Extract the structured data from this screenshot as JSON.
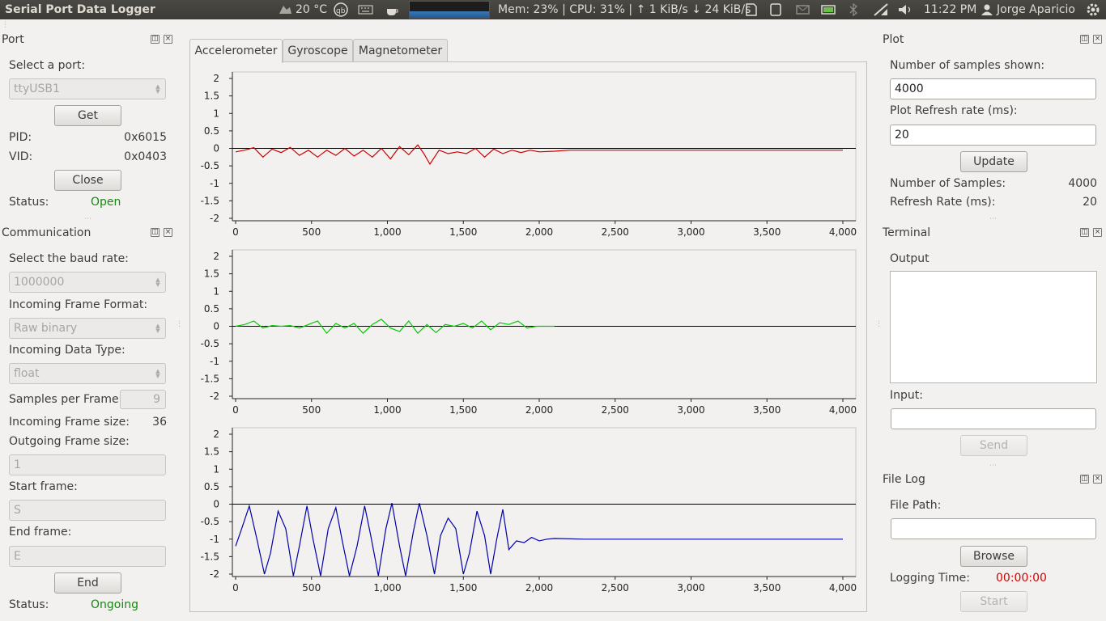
{
  "topbar": {
    "title": "Serial Port Data Logger",
    "weather": "20 °C",
    "sysmon": "Mem: 23% | CPU: 31% | ↑ 1 KiB/s ↓ 24 KiB/s",
    "time": "11:22 PM",
    "user": "Jorge Aparicio"
  },
  "port": {
    "title": "Port",
    "select_label": "Select a port:",
    "port_value": "ttyUSB1",
    "get_label": "Get",
    "pid_label": "PID:",
    "pid_value": "0x6015",
    "vid_label": "VID:",
    "vid_value": "0x0403",
    "close_label": "Close",
    "status_label": "Status:",
    "status_value": "Open"
  },
  "communication": {
    "title": "Communication",
    "baud_label": "Select the baud rate:",
    "baud_value": "1000000",
    "frame_format_label": "Incoming Frame Format:",
    "frame_format_value": "Raw binary",
    "data_type_label": "Incoming Data Type:",
    "data_type_value": "float",
    "samples_label": "Samples per Frame:",
    "samples_value": "9",
    "in_size_label": "Incoming Frame size:",
    "in_size_value": "36",
    "out_size_label": "Outgoing Frame size:",
    "out_size_value": "1",
    "start_label": "Start frame:",
    "start_value": "S",
    "end_label": "End frame:",
    "end_value": "E",
    "end_button": "End",
    "status_label": "Status:",
    "status_value": "Ongoing"
  },
  "tabs": [
    "Accelerometer",
    "Gyroscope",
    "Magnetometer"
  ],
  "plot_settings": {
    "title": "Plot",
    "samples_label": "Number of samples shown:",
    "samples_value": "4000",
    "refresh_label": "Plot Refresh rate (ms):",
    "refresh_value": "20",
    "update_label": "Update",
    "num_samples_label": "Number of Samples:",
    "num_samples_value": "4000",
    "refresh_rate_label": "Refresh Rate (ms):",
    "refresh_rate_value": "20"
  },
  "terminal": {
    "title": "Terminal",
    "output_label": "Output",
    "input_label": "Input:",
    "input_value": "",
    "send_label": "Send"
  },
  "filelog": {
    "title": "File Log",
    "path_label": "File Path:",
    "path_value": "",
    "browse_label": "Browse",
    "time_label": "Logging Time:",
    "time_value": "00:00:00",
    "start_label": "Start"
  },
  "chart_data": [
    {
      "type": "line",
      "color": "#cc0000",
      "xlim": [
        0,
        4000
      ],
      "ylim": [
        -2,
        2
      ],
      "xticks": [
        "0",
        "500",
        "1,000",
        "1,500",
        "2,000",
        "2,500",
        "3,000",
        "3,500",
        "4,000"
      ],
      "yticks": [
        "2",
        "1.5",
        "1",
        "0.5",
        "0",
        "-0.5",
        "-1",
        "-1.5",
        "-2"
      ],
      "series": [
        {
          "x": [
            0,
            60,
            120,
            180,
            240,
            300,
            360,
            420,
            480,
            540,
            600,
            660,
            720,
            780,
            840,
            900,
            960,
            1020,
            1080,
            1140,
            1200,
            1240,
            1280,
            1340,
            1400,
            1460,
            1520,
            1580,
            1640,
            1700,
            1760,
            1820,
            1880,
            1940,
            2000,
            2100,
            2200,
            2400,
            2600,
            3000,
            3500,
            4000
          ],
          "y": [
            -0.1,
            -0.05,
            0.02,
            -0.25,
            -0.02,
            -0.12,
            0.03,
            -0.2,
            -0.05,
            -0.25,
            -0.05,
            -0.2,
            0.0,
            -0.22,
            -0.05,
            -0.25,
            0.0,
            -0.3,
            0.05,
            -0.18,
            0.1,
            -0.15,
            -0.45,
            -0.05,
            -0.15,
            -0.1,
            -0.15,
            0.0,
            -0.25,
            -0.02,
            -0.15,
            -0.05,
            -0.12,
            -0.05,
            -0.1,
            -0.08,
            -0.05,
            -0.05,
            -0.05,
            -0.05,
            -0.05,
            -0.05
          ]
        }
      ]
    },
    {
      "type": "line",
      "color": "#00cc00",
      "xlim": [
        0,
        4000
      ],
      "ylim": [
        -2,
        2
      ],
      "xticks": [
        "0",
        "500",
        "1,000",
        "1,500",
        "2,000",
        "2,500",
        "3,000",
        "3,500",
        "4,000"
      ],
      "yticks": [
        "2",
        "1.5",
        "1",
        "0.5",
        "0",
        "-0.5",
        "-1",
        "-1.5",
        "-2"
      ],
      "series": [
        {
          "x": [
            0,
            60,
            120,
            180,
            240,
            300,
            360,
            420,
            480,
            540,
            600,
            660,
            720,
            780,
            840,
            900,
            960,
            1020,
            1080,
            1140,
            1200,
            1260,
            1320,
            1380,
            1440,
            1500,
            1560,
            1620,
            1680,
            1740,
            1800,
            1860,
            1920,
            1980,
            2050,
            2100
          ],
          "y": [
            0.0,
            0.05,
            0.15,
            -0.05,
            0.02,
            0.0,
            0.02,
            -0.05,
            0.05,
            0.15,
            -0.2,
            0.08,
            -0.05,
            0.08,
            -0.2,
            0.05,
            0.2,
            -0.05,
            -0.15,
            0.15,
            -0.2,
            0.05,
            -0.18,
            0.05,
            0.0,
            0.08,
            -0.05,
            0.15,
            -0.1,
            0.1,
            0.05,
            0.15,
            -0.05,
            0.0,
            0.0,
            0.0
          ]
        }
      ]
    },
    {
      "type": "line",
      "color": "#0000aa",
      "xlim": [
        0,
        4000
      ],
      "ylim": [
        -2,
        2
      ],
      "xticks": [
        "0",
        "500",
        "1,000",
        "1,500",
        "2,000",
        "2,500",
        "3,000",
        "3,500",
        "4,000"
      ],
      "yticks": [
        "2",
        "1.5",
        "1",
        "0.5",
        "0",
        "-0.5",
        "-1",
        "-1.5",
        "-2"
      ],
      "series": [
        {
          "x": [
            0,
            40,
            90,
            140,
            190,
            230,
            280,
            330,
            380,
            420,
            470,
            510,
            560,
            610,
            660,
            700,
            750,
            800,
            850,
            890,
            940,
            990,
            1030,
            1080,
            1120,
            1170,
            1210,
            1260,
            1310,
            1350,
            1400,
            1450,
            1500,
            1540,
            1590,
            1640,
            1680,
            1720,
            1760,
            1800,
            1850,
            1900,
            1950,
            2000,
            2050,
            2100,
            2300,
            2500,
            3000,
            3600,
            3800,
            4000
          ],
          "y": [
            -1.2,
            -0.7,
            -0.05,
            -1.0,
            -2.0,
            -1.4,
            -0.2,
            -0.7,
            -2.05,
            -1.2,
            -0.05,
            -1.0,
            -2.05,
            -0.7,
            -0.1,
            -1.0,
            -2.05,
            -1.2,
            -0.05,
            -0.9,
            -2.05,
            -0.7,
            0.03,
            -1.2,
            -2.05,
            -0.8,
            0.03,
            -0.9,
            -2.0,
            -0.9,
            -0.4,
            -0.7,
            -2.0,
            -1.4,
            -0.2,
            -0.9,
            -2.0,
            -1.0,
            -0.15,
            -1.3,
            -1.05,
            -1.1,
            -0.95,
            -1.05,
            -1.0,
            -0.98,
            -1.0,
            -1.0,
            -1.0,
            -1.0,
            -1.0,
            -1.0
          ]
        }
      ]
    }
  ]
}
